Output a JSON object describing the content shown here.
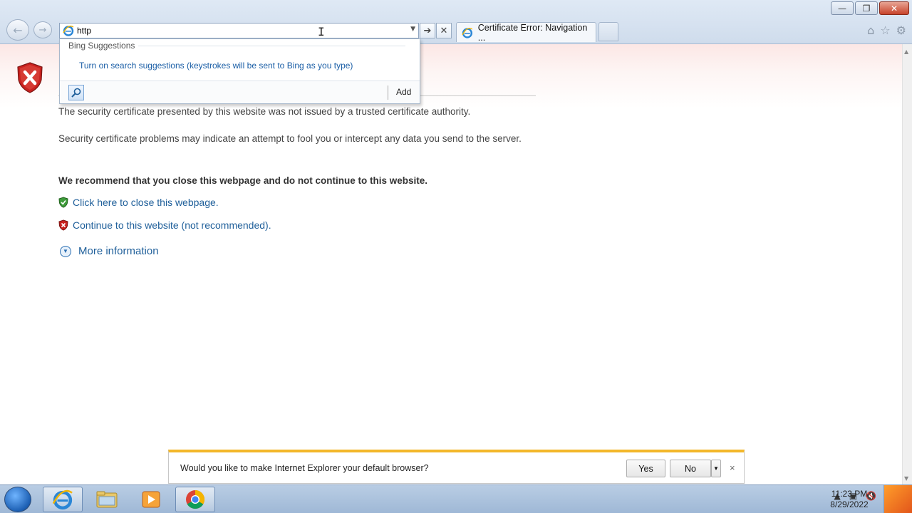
{
  "window": {
    "minimize_glyph": "—",
    "restore_glyph": "❐",
    "close_glyph": "✕"
  },
  "nav": {
    "back_glyph": "←",
    "forward_glyph": "→"
  },
  "address": {
    "value": "http",
    "go_glyph": "➔",
    "stop_glyph": "✕"
  },
  "tab": {
    "title": "Certificate Error: Navigation ..."
  },
  "toolbar": {
    "home_glyph": "⌂",
    "favorites_glyph": "☆",
    "tools_glyph": "⚙"
  },
  "dropdown": {
    "heading": "Bing Suggestions",
    "suggestion": "Turn on search suggestions (keystrokes will be sent to Bing as you type)",
    "add_label": "Add"
  },
  "content": {
    "para1": "The security certificate presented by this website was not issued by a trusted certificate authority.",
    "para2": "Security certificate problems may indicate an attempt to fool you or intercept any data you send to the server.",
    "recommend": "We recommend that you close this webpage and do not continue to this website.",
    "close_link": "Click here to close this webpage.",
    "continue_link": "Continue to this website (not recommended).",
    "more_info": "More information"
  },
  "notification": {
    "message": "Would you like to make Internet Explorer your default browser?",
    "yes_label": "Yes",
    "no_label": "No",
    "close_glyph": "×"
  },
  "taskbar": {
    "time": "11:23 PM",
    "date": "8/29/2022"
  },
  "colors": {
    "link": "#1f5f9a",
    "warning_bar": "#f3b72a",
    "shield_red": "#c9211e"
  }
}
